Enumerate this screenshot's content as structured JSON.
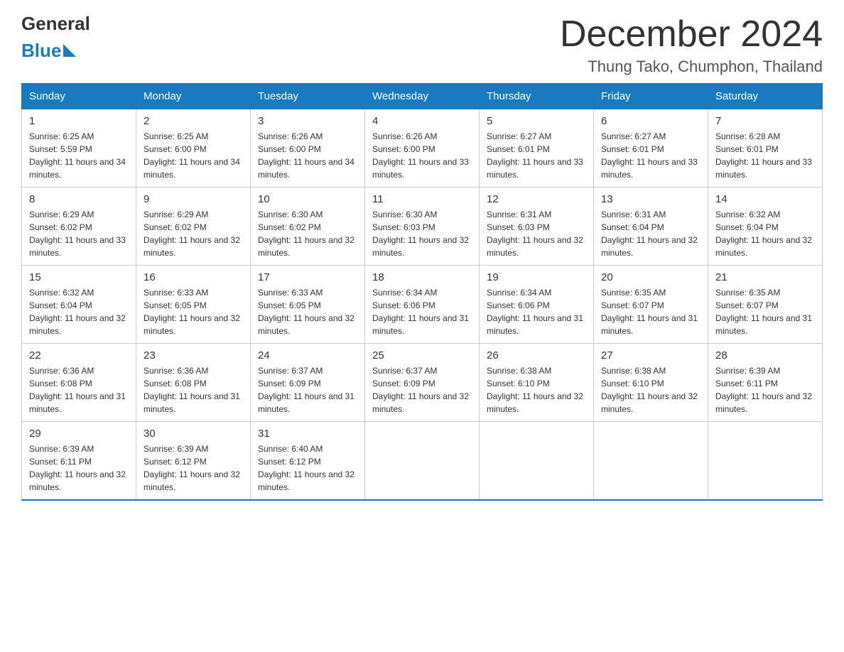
{
  "logo": {
    "line1": "General",
    "line2": "Blue"
  },
  "header": {
    "month": "December 2024",
    "location": "Thung Tako, Chumphon, Thailand"
  },
  "weekdays": [
    "Sunday",
    "Monday",
    "Tuesday",
    "Wednesday",
    "Thursday",
    "Friday",
    "Saturday"
  ],
  "weeks": [
    [
      {
        "day": "1",
        "sunrise": "6:25 AM",
        "sunset": "5:59 PM",
        "daylight": "11 hours and 34 minutes."
      },
      {
        "day": "2",
        "sunrise": "6:25 AM",
        "sunset": "6:00 PM",
        "daylight": "11 hours and 34 minutes."
      },
      {
        "day": "3",
        "sunrise": "6:26 AM",
        "sunset": "6:00 PM",
        "daylight": "11 hours and 34 minutes."
      },
      {
        "day": "4",
        "sunrise": "6:26 AM",
        "sunset": "6:00 PM",
        "daylight": "11 hours and 33 minutes."
      },
      {
        "day": "5",
        "sunrise": "6:27 AM",
        "sunset": "6:01 PM",
        "daylight": "11 hours and 33 minutes."
      },
      {
        "day": "6",
        "sunrise": "6:27 AM",
        "sunset": "6:01 PM",
        "daylight": "11 hours and 33 minutes."
      },
      {
        "day": "7",
        "sunrise": "6:28 AM",
        "sunset": "6:01 PM",
        "daylight": "11 hours and 33 minutes."
      }
    ],
    [
      {
        "day": "8",
        "sunrise": "6:29 AM",
        "sunset": "6:02 PM",
        "daylight": "11 hours and 33 minutes."
      },
      {
        "day": "9",
        "sunrise": "6:29 AM",
        "sunset": "6:02 PM",
        "daylight": "11 hours and 32 minutes."
      },
      {
        "day": "10",
        "sunrise": "6:30 AM",
        "sunset": "6:02 PM",
        "daylight": "11 hours and 32 minutes."
      },
      {
        "day": "11",
        "sunrise": "6:30 AM",
        "sunset": "6:03 PM",
        "daylight": "11 hours and 32 minutes."
      },
      {
        "day": "12",
        "sunrise": "6:31 AM",
        "sunset": "6:03 PM",
        "daylight": "11 hours and 32 minutes."
      },
      {
        "day": "13",
        "sunrise": "6:31 AM",
        "sunset": "6:04 PM",
        "daylight": "11 hours and 32 minutes."
      },
      {
        "day": "14",
        "sunrise": "6:32 AM",
        "sunset": "6:04 PM",
        "daylight": "11 hours and 32 minutes."
      }
    ],
    [
      {
        "day": "15",
        "sunrise": "6:32 AM",
        "sunset": "6:04 PM",
        "daylight": "11 hours and 32 minutes."
      },
      {
        "day": "16",
        "sunrise": "6:33 AM",
        "sunset": "6:05 PM",
        "daylight": "11 hours and 32 minutes."
      },
      {
        "day": "17",
        "sunrise": "6:33 AM",
        "sunset": "6:05 PM",
        "daylight": "11 hours and 32 minutes."
      },
      {
        "day": "18",
        "sunrise": "6:34 AM",
        "sunset": "6:06 PM",
        "daylight": "11 hours and 31 minutes."
      },
      {
        "day": "19",
        "sunrise": "6:34 AM",
        "sunset": "6:06 PM",
        "daylight": "11 hours and 31 minutes."
      },
      {
        "day": "20",
        "sunrise": "6:35 AM",
        "sunset": "6:07 PM",
        "daylight": "11 hours and 31 minutes."
      },
      {
        "day": "21",
        "sunrise": "6:35 AM",
        "sunset": "6:07 PM",
        "daylight": "11 hours and 31 minutes."
      }
    ],
    [
      {
        "day": "22",
        "sunrise": "6:36 AM",
        "sunset": "6:08 PM",
        "daylight": "11 hours and 31 minutes."
      },
      {
        "day": "23",
        "sunrise": "6:36 AM",
        "sunset": "6:08 PM",
        "daylight": "11 hours and 31 minutes."
      },
      {
        "day": "24",
        "sunrise": "6:37 AM",
        "sunset": "6:09 PM",
        "daylight": "11 hours and 31 minutes."
      },
      {
        "day": "25",
        "sunrise": "6:37 AM",
        "sunset": "6:09 PM",
        "daylight": "11 hours and 32 minutes."
      },
      {
        "day": "26",
        "sunrise": "6:38 AM",
        "sunset": "6:10 PM",
        "daylight": "11 hours and 32 minutes."
      },
      {
        "day": "27",
        "sunrise": "6:38 AM",
        "sunset": "6:10 PM",
        "daylight": "11 hours and 32 minutes."
      },
      {
        "day": "28",
        "sunrise": "6:39 AM",
        "sunset": "6:11 PM",
        "daylight": "11 hours and 32 minutes."
      }
    ],
    [
      {
        "day": "29",
        "sunrise": "6:39 AM",
        "sunset": "6:11 PM",
        "daylight": "11 hours and 32 minutes."
      },
      {
        "day": "30",
        "sunrise": "6:39 AM",
        "sunset": "6:12 PM",
        "daylight": "11 hours and 32 minutes."
      },
      {
        "day": "31",
        "sunrise": "6:40 AM",
        "sunset": "6:12 PM",
        "daylight": "11 hours and 32 minutes."
      },
      null,
      null,
      null,
      null
    ]
  ]
}
